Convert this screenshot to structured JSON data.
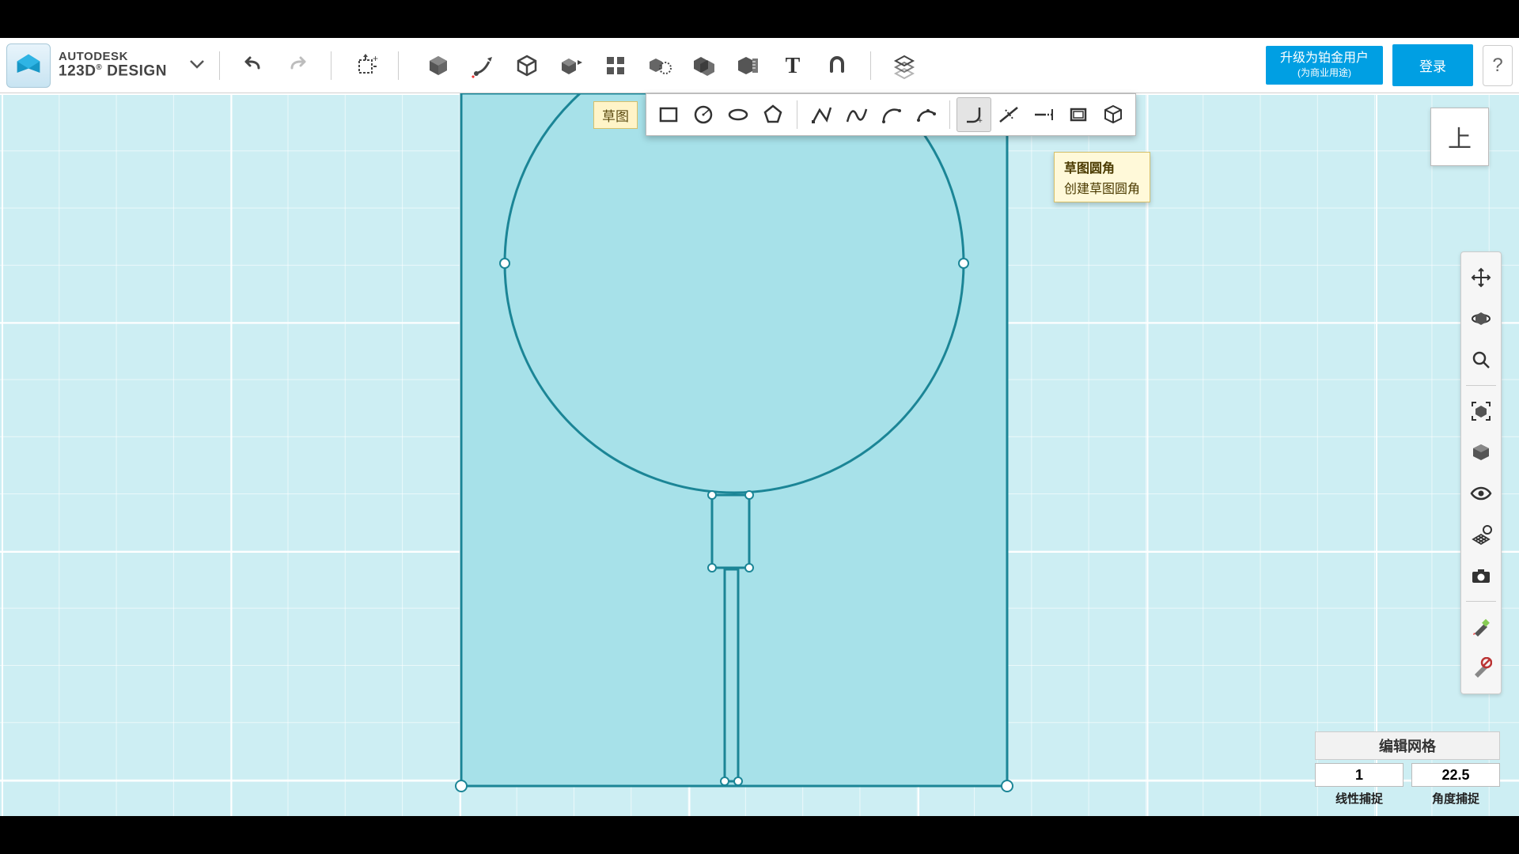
{
  "brand": {
    "line1": "AUTODESK",
    "line2a": "123D",
    "sup": "®",
    "line2b": "DESIGN"
  },
  "header": {
    "upgrade_title": "升级为铂金用户",
    "upgrade_sub": "(为商业用途)",
    "signin": "登录",
    "help": "?"
  },
  "subtoolbar": {
    "label": "草图"
  },
  "tooltip": {
    "title": "草图圆角",
    "body": "创建草图圆角"
  },
  "viewcube": {
    "face": "上"
  },
  "snap": {
    "title": "编辑网格",
    "linear_val": "1",
    "linear_lbl": "线性捕捉",
    "angular_val": "22.5",
    "angular_lbl": "角度捕捉"
  }
}
